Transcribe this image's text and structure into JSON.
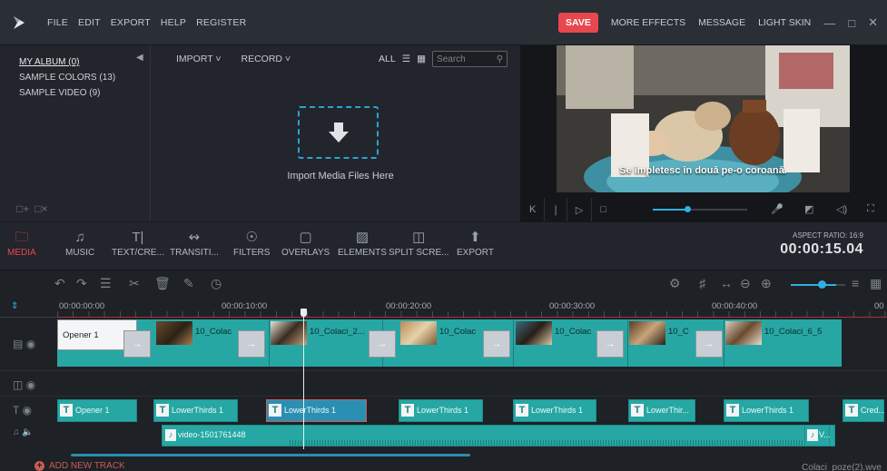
{
  "menu": [
    "FILE",
    "EDIT",
    "EXPORT",
    "HELP",
    "REGISTER"
  ],
  "topbar": {
    "save": "SAVE",
    "links": [
      "MORE EFFECTS",
      "MESSAGE",
      "LIGHT SKIN"
    ]
  },
  "album": {
    "items": [
      "MY ALBUM (0)",
      "SAMPLE COLORS (13)",
      "SAMPLE VIDEO (9)"
    ]
  },
  "library": {
    "import": "IMPORT",
    "record": "RECORD",
    "all": "ALL",
    "search_placeholder": "Search",
    "drop_label": "Import Media Files Here"
  },
  "preview": {
    "subtitle": "Se împletesc în două pe-o coroană.",
    "volume_level": 0.37
  },
  "tools": [
    "MEDIA",
    "MUSIC",
    "TEXT/CRE...",
    "TRANSITI...",
    "FILTERS",
    "OVERLAYS",
    "ELEMENTS",
    "SPLIT SCRE...",
    "EXPORT"
  ],
  "aspect": {
    "label": "ASPECT RATIO: 16:9",
    "time": "00:00:15.04"
  },
  "ruler": [
    "00:00:00:00",
    "00:00:10:00",
    "00:00:20:00",
    "00:00:30:00",
    "00:00:40:00",
    "00"
  ],
  "video_track": {
    "opener": "Opener 1",
    "clips": [
      "10_Colac",
      "10_Colaci_2...",
      "10_Colac",
      "10_Colac",
      "10_C",
      "10_Colaci_6_5"
    ]
  },
  "title_track": {
    "clips": [
      "Opener 1",
      "LowerThirds 1",
      "LowerThirds 1",
      "LowerThirds 1",
      "LowerThirds 1",
      "LowerThir...",
      "LowerThirds 1",
      "Cred..."
    ]
  },
  "audio_track": {
    "clip": "video-1501761448",
    "clip2": "V..."
  },
  "footer": {
    "add_track": "ADD NEW TRACK",
    "project": "Colaci_poze(2).wve"
  },
  "colors": {
    "accent": "#e8474f",
    "clip": "#26a7a4",
    "highlight": "#2fb0e3"
  }
}
